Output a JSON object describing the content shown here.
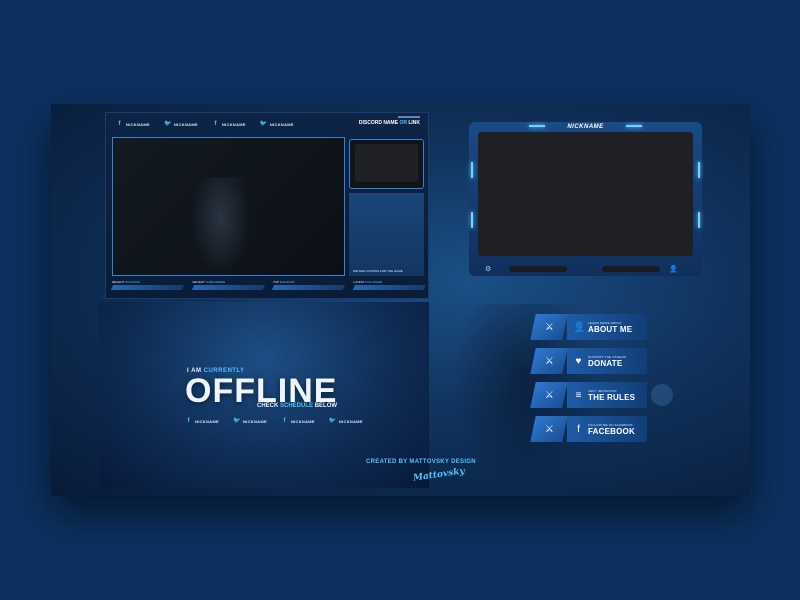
{
  "overlay": {
    "social": [
      {
        "icon": "facebook-icon",
        "glyph": "f",
        "name": "NICKNAME"
      },
      {
        "icon": "twitter-icon",
        "glyph": "🐦",
        "name": "NICKNAME"
      },
      {
        "icon": "facebook-icon",
        "glyph": "f",
        "name": "NICKNAME"
      },
      {
        "icon": "twitter-icon",
        "glyph": "🐦",
        "name": "NICKNAME"
      }
    ],
    "discord": {
      "prefix": "DISCORD NAME ",
      "highlight": "OR",
      "suffix": " LINK"
    },
    "chat_label": "WE ARE LOOKING FOR THE GAME",
    "alerts": [
      {
        "label": "RECENT",
        "highlight": "DONATOR"
      },
      {
        "label": "RECENT",
        "highlight": "SUBSCRIBER"
      },
      {
        "label": "TOP",
        "highlight": "DONATOR"
      },
      {
        "label": "LATEST",
        "highlight": "FOLLOWER"
      }
    ]
  },
  "offline_screen": {
    "line1_prefix": "I AM ",
    "line1_highlight": "CURRENTLY",
    "headline": "OFFLINE",
    "line2_prefix": "CHECK ",
    "line2_highlight": "SCHEDULE",
    "line2_suffix": " BELOW",
    "social": [
      {
        "icon": "facebook-icon",
        "glyph": "f",
        "name": "NICKNAME"
      },
      {
        "icon": "twitter-icon",
        "glyph": "🐦",
        "name": "NICKNAME"
      },
      {
        "icon": "facebook-icon",
        "glyph": "f",
        "name": "NICKNAME"
      },
      {
        "icon": "twitter-icon",
        "glyph": "🐦",
        "name": "NICKNAME"
      }
    ]
  },
  "webcam": {
    "nickname": "NICKNAME"
  },
  "credits": {
    "created_by": "CREATED BY MATTOVSKY DESIGN",
    "signature": "Mattovsky"
  },
  "panels": [
    {
      "icon": "user-icon",
      "glyph": "👤",
      "subtitle": "LEARN MORE ABOUT",
      "title": "ABOUT ME"
    },
    {
      "icon": "heart-hand-icon",
      "glyph": "♥",
      "subtitle": "SUPPORT THE STREAM",
      "title": "DONATE"
    },
    {
      "icon": "document-icon",
      "glyph": "≡",
      "subtitle": "VERY IMPORTANT",
      "title": "THE RULES"
    },
    {
      "icon": "facebook-icon",
      "glyph": "f",
      "subtitle": "FOLLOW ME ON FACEBOOK",
      "title": "FACEBOOK"
    }
  ],
  "colors": {
    "background": "#0c3160",
    "accent": "#4fc3ff",
    "panel": "#1f5ba6"
  }
}
